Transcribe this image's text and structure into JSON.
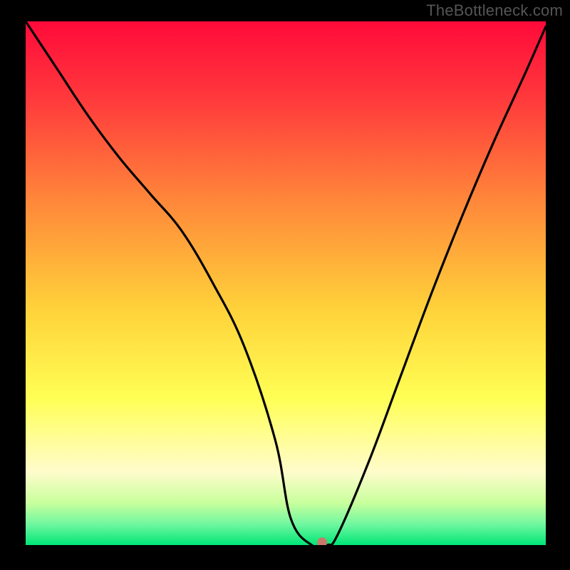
{
  "watermark": "TheBottleneck.com",
  "chart_data": {
    "type": "line",
    "title": "",
    "xlabel": "",
    "ylabel": "",
    "xlim": [
      0,
      100
    ],
    "ylim": [
      0,
      100
    ],
    "gradient_stops": [
      {
        "offset": 0,
        "color": "#ff0a3a"
      },
      {
        "offset": 0.15,
        "color": "#ff3a3c"
      },
      {
        "offset": 0.35,
        "color": "#ff8a3a"
      },
      {
        "offset": 0.55,
        "color": "#ffd23a"
      },
      {
        "offset": 0.72,
        "color": "#ffff55"
      },
      {
        "offset": 0.86,
        "color": "#fffccc"
      },
      {
        "offset": 0.92,
        "color": "#c8ff9c"
      },
      {
        "offset": 0.96,
        "color": "#70f7a0"
      },
      {
        "offset": 1.0,
        "color": "#00e676"
      }
    ],
    "series": [
      {
        "name": "bottleneck-curve",
        "x": [
          0,
          6,
          12,
          18,
          24,
          30,
          36,
          42,
          48,
          51,
          55,
          58,
          60,
          66,
          72,
          78,
          84,
          90,
          96,
          100
        ],
        "y": [
          100,
          91,
          82,
          74,
          67,
          60,
          50,
          38,
          20,
          5,
          0,
          0,
          2,
          16,
          32,
          48,
          63,
          77,
          90,
          99
        ]
      }
    ],
    "marker": {
      "x": 57,
      "y": 0.5,
      "color": "#c97a6a",
      "radius": 7
    }
  }
}
